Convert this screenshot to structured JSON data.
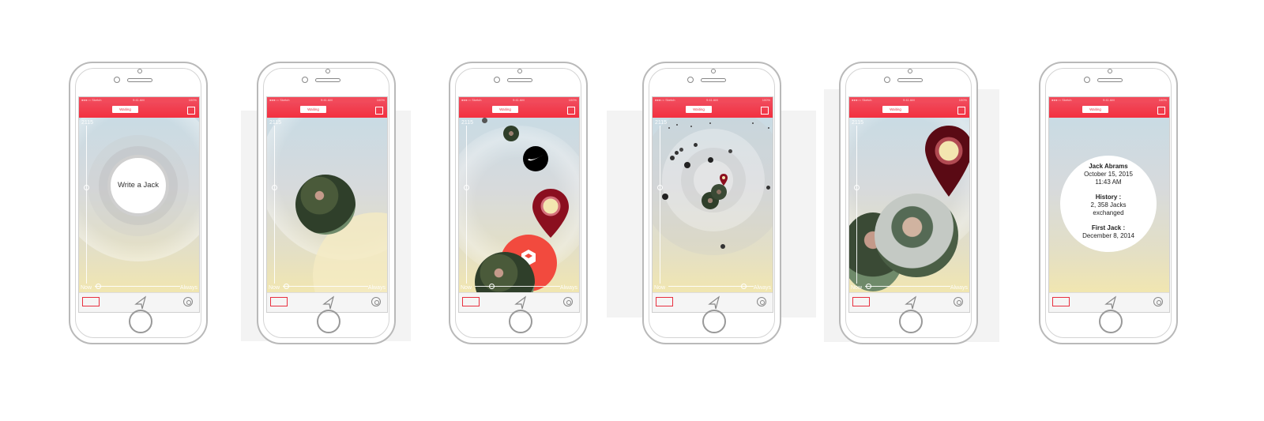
{
  "status": {
    "carrier": "●●●○○ Sketch",
    "time": "9:41 AM",
    "battery": "100%"
  },
  "nav": {
    "pill_label": "Waiting"
  },
  "slider": {
    "top_label": "2115",
    "left_label": "Now",
    "right_label": "Always"
  },
  "screen1": {
    "center_text": "Write a Jack"
  },
  "screen6": {
    "name": "Jack Abrams",
    "date": "October 15, 2015",
    "time": "11:43 AM",
    "history_label": "History :",
    "history_value": "2, 358 Jacks exchanged",
    "first_label": "First Jack :",
    "first_value": "December 8, 2014"
  },
  "colors": {
    "accent": "#f3303f",
    "pin": "#8b0f1f",
    "pin_center": "#f3e6b0"
  },
  "icons": [
    "rectangle-tab-icon",
    "send-arrow-icon",
    "target-icon",
    "nike-swoosh-icon",
    "location-pin-icon",
    "home-icon"
  ]
}
